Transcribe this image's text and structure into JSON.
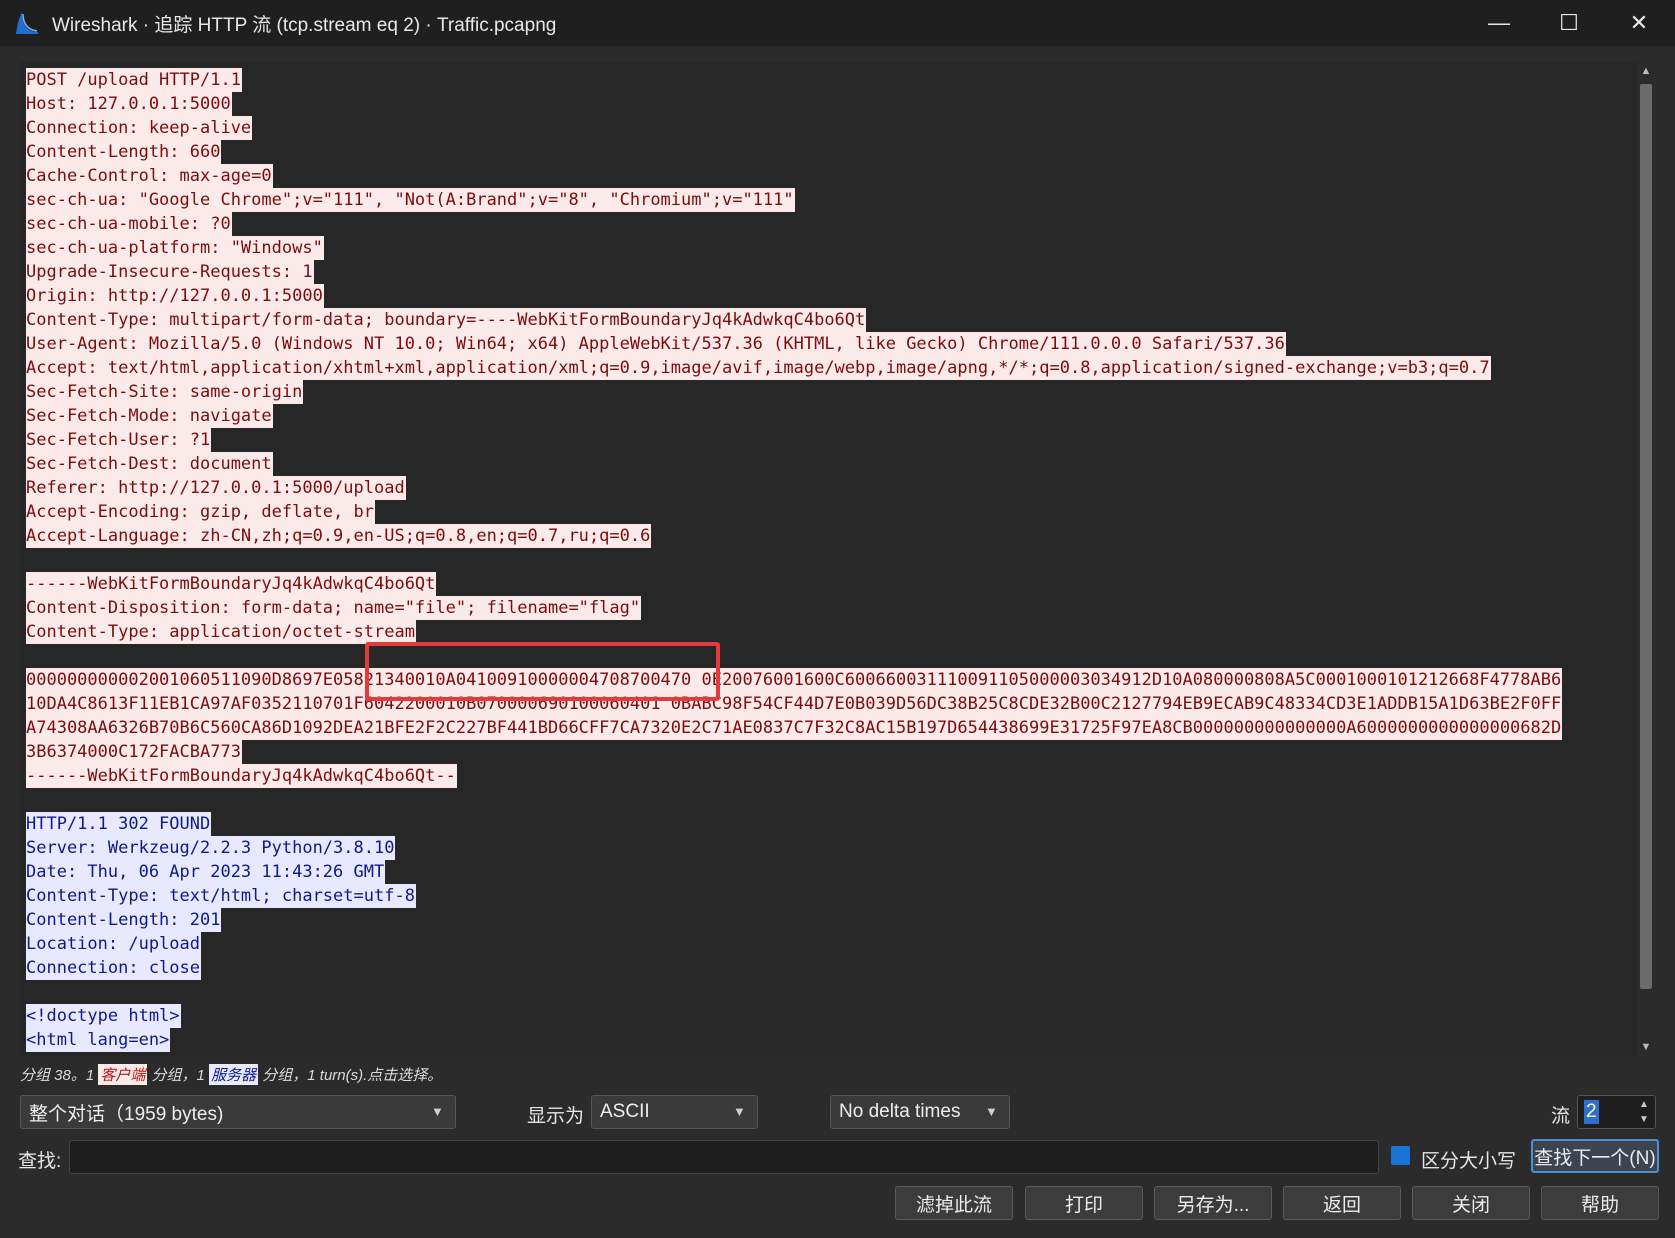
{
  "window": {
    "title": "Wireshark · 追踪 HTTP 流 (tcp.stream eq 2) · Traffic.pcapng",
    "minimize": "—",
    "maximize": "☐",
    "close": "✕"
  },
  "stream": {
    "lines": [
      {
        "dir": "client",
        "text": "POST /upload HTTP/1.1"
      },
      {
        "dir": "client",
        "text": "Host: 127.0.0.1:5000"
      },
      {
        "dir": "client",
        "text": "Connection: keep-alive"
      },
      {
        "dir": "client",
        "text": "Content-Length: 660"
      },
      {
        "dir": "client",
        "text": "Cache-Control: max-age=0"
      },
      {
        "dir": "client",
        "text": "sec-ch-ua: \"Google Chrome\";v=\"111\", \"Not(A:Brand\";v=\"8\", \"Chromium\";v=\"111\""
      },
      {
        "dir": "client",
        "text": "sec-ch-ua-mobile: ?0"
      },
      {
        "dir": "client",
        "text": "sec-ch-ua-platform: \"Windows\""
      },
      {
        "dir": "client",
        "text": "Upgrade-Insecure-Requests: 1"
      },
      {
        "dir": "client",
        "text": "Origin: http://127.0.0.1:5000"
      },
      {
        "dir": "client",
        "text": "Content-Type: multipart/form-data; boundary=----WebKitFormBoundaryJq4kAdwkqC4bo6Qt"
      },
      {
        "dir": "client",
        "text": "User-Agent: Mozilla/5.0 (Windows NT 10.0; Win64; x64) AppleWebKit/537.36 (KHTML, like Gecko) Chrome/111.0.0.0 Safari/537.36"
      },
      {
        "dir": "client",
        "text": "Accept: text/html,application/xhtml+xml,application/xml;q=0.9,image/avif,image/webp,image/apng,*/*;q=0.8,application/signed-exchange;v=b3;q=0.7"
      },
      {
        "dir": "client",
        "text": "Sec-Fetch-Site: same-origin"
      },
      {
        "dir": "client",
        "text": "Sec-Fetch-Mode: navigate"
      },
      {
        "dir": "client",
        "text": "Sec-Fetch-User: ?1"
      },
      {
        "dir": "client",
        "text": "Sec-Fetch-Dest: document"
      },
      {
        "dir": "client",
        "text": "Referer: http://127.0.0.1:5000/upload"
      },
      {
        "dir": "client",
        "text": "Accept-Encoding: gzip, deflate, br"
      },
      {
        "dir": "client",
        "text": "Accept-Language: zh-CN,zh;q=0.9,en-US;q=0.8,en;q=0.7,ru;q=0.6"
      },
      {
        "dir": "blank",
        "text": ""
      },
      {
        "dir": "client",
        "text": "------WebKitFormBoundaryJq4kAdwkqC4bo6Qt"
      },
      {
        "dir": "client",
        "text": "Content-Disposition: form-data; name=\"file\"; filename=\"flag\""
      },
      {
        "dir": "client",
        "text": "Content-Type: application/octet-stream"
      },
      {
        "dir": "blank",
        "text": ""
      },
      {
        "dir": "client",
        "text": "000000000002001060511090D8697E05821340010A04100910000004708700470 0E20076001600C600660031110091105000003034912D10A080000808A5C0001000101212668F4778AB6"
      },
      {
        "dir": "client",
        "text": "10DA4C8613F11EB1CA97AF0352110701F6042200010B070000690100060401 0BABC98F54CF44D7E0B039D56DC38B25C8CDE32B00C2127794EB9ECAB9C48334CD3E1ADDB15A1D63BE2F0FF"
      },
      {
        "dir": "client",
        "text": "A74308AA6326B70B6C560CA86D1092DEA21BFE2F2C227BF441BD66CFF7CA7320E2C71AE0837C7F32C8AC15B197D654438699E31725F97EA8CB000000000000000A6000000000000000682D"
      },
      {
        "dir": "client",
        "text": "3B6374000C172FACBA773"
      },
      {
        "dir": "client",
        "text": "------WebKitFormBoundaryJq4kAdwkqC4bo6Qt--"
      },
      {
        "dir": "blank",
        "text": ""
      },
      {
        "dir": "server",
        "text": "HTTP/1.1 302 FOUND"
      },
      {
        "dir": "server",
        "text": "Server: Werkzeug/2.2.3 Python/3.8.10"
      },
      {
        "dir": "server",
        "text": "Date: Thu, 06 Apr 2023 11:43:26 GMT"
      },
      {
        "dir": "server",
        "text": "Content-Type: text/html; charset=utf-8"
      },
      {
        "dir": "server",
        "text": "Content-Length: 201"
      },
      {
        "dir": "server",
        "text": "Location: /upload"
      },
      {
        "dir": "server",
        "text": "Connection: close"
      },
      {
        "dir": "blank",
        "text": ""
      },
      {
        "dir": "server",
        "text": "<!doctype html>"
      },
      {
        "dir": "server",
        "text": "<html lang=en>"
      }
    ]
  },
  "summary": {
    "prefix": "分组 38。1 ",
    "client_tag": "客户端",
    "middle": " 分组，1 ",
    "server_tag": "服务器",
    "suffix": " 分组，1 turn(s).点击选择。"
  },
  "controls": {
    "conversation_select": "整个对话（1959 bytes)",
    "show_as_label": "显示为",
    "show_as_value": "ASCII",
    "delta_select": "No delta times",
    "stream_label": "流",
    "stream_value": "2",
    "find_label": "查找:",
    "find_value": "",
    "case_label": "区分大小写",
    "find_next": "查找下一个(N)"
  },
  "buttons": {
    "filter_out": "滤掉此流",
    "print": "打印",
    "save_as": "另存为...",
    "back": "返回",
    "close": "关闭",
    "help": "帮助"
  },
  "colors": {
    "client_bg": "#fbeaea",
    "client_fg": "#7d0c0c",
    "server_bg": "#e8e9ff",
    "server_fg": "#0c1a8a",
    "highlight_box": "#e23b3b",
    "accent": "#1a74d6"
  }
}
